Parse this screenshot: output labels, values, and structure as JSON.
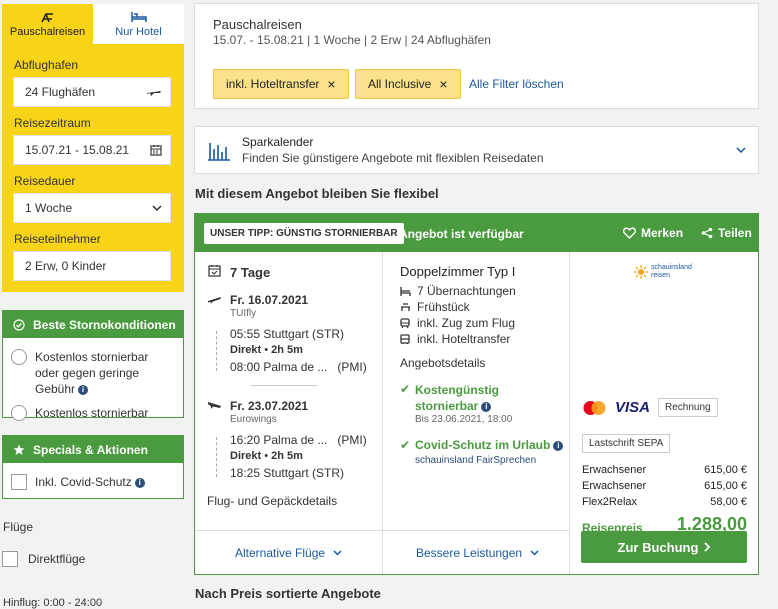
{
  "sidebar": {
    "tabs": [
      {
        "label": "Pauschalreisen",
        "icon": "beach-chair-icon",
        "active": true
      },
      {
        "label": "Nur Hotel",
        "icon": "bed-icon",
        "active": false
      }
    ],
    "fields": [
      {
        "label": "Abflughafen",
        "value": "24 Flughäfen",
        "icon": "plane-icon"
      },
      {
        "label": "Reisezeitraum",
        "value": "15.07.21 - 15.08.21",
        "icon": "calendar-icon"
      },
      {
        "label": "Reisedauer",
        "value": "1 Woche",
        "icon": "chevron-down-icon"
      },
      {
        "label": "Reiseteilnehmer",
        "value": "2 Erw, 0 Kinder",
        "icon": ""
      }
    ],
    "storno": {
      "title": "Beste Stornokonditionen",
      "options": [
        "Kostenlos stornierbar oder gegen geringe Gebühr",
        "Kostenlos stornierbar"
      ]
    },
    "specials": {
      "title": "Specials & Aktionen",
      "options": [
        "Inkl. Covid-Schutz"
      ]
    },
    "fluege": {
      "title": "Flüge",
      "direct": "Direktflüge",
      "hinflug": "Hinflug: 0:00 - 24:00"
    }
  },
  "summary": {
    "title": "Pauschalreisen",
    "details": "15.07. - 15.08.21 | 1 Woche | 2 Erw | 24 Abflughäfen",
    "chips": [
      "inkl. Hoteltransfer",
      "All Inclusive"
    ],
    "clear_filters": "Alle Filter löschen"
  },
  "sparkalender": {
    "title": "Sparkalender",
    "subtitle": "Finden Sie günstigere Angebote mit flexiblen Reisedaten"
  },
  "flex_heading": "Mit diesem Angebot bleiben Sie flexibel",
  "offer": {
    "badge": "UNSER TIPP: GÜNSTIG STORNIERBAR",
    "available": "Angebot ist verfügbar",
    "save": "Merken",
    "share": "Teilen",
    "duration": "7 Tage",
    "outbound": {
      "date": "Fr. 16.07.2021",
      "airline": "TUIfly",
      "dep_time_place": "05:55 Stuttgart (STR)",
      "direct": "Direkt",
      "duration": "2h 5m",
      "arr_time_place": "08:00 Palma de ...",
      "arr_code": "(PMI)"
    },
    "inbound": {
      "date": "Fr. 23.07.2021",
      "airline": "Eurowings",
      "dep_time_place": "16:20 Palma de ...",
      "dep_code": "(PMI)",
      "direct": "Direkt",
      "duration": "2h 5m",
      "arr_time_place": "18:25 Stuttgart (STR)"
    },
    "flight_details": "Flug- und Gepäckdetails",
    "alt_flights": "Alternative Flüge",
    "room": "Doppelzimmer Typ I",
    "features": [
      "7 Übernachtungen",
      "Frühstück",
      "inkl. Zug zum Flug",
      "inkl. Hoteltransfer"
    ],
    "offer_details": "Angebotsdetails",
    "cancel_title": "Kostengünstig stornierbar",
    "cancel_until": "Bis 23.06.2021, 18:00",
    "covid_title": "Covid-Schutz im Urlaub",
    "covid_sub": "schauinsland FairSprechen",
    "better_services": "Bessere Leistungen",
    "operator": "schauinsland reisen",
    "payment": [
      "VISA",
      "Rechnung",
      "Lastschrift SEPA"
    ],
    "prices": [
      {
        "label": "Erwachsener",
        "value": "615,00 €"
      },
      {
        "label": "Erwachsener",
        "value": "615,00 €"
      },
      {
        "label": "Flex2Relax",
        "value": "58,00 €"
      }
    ],
    "total_label": "Reisepreis",
    "total_value": "1.288,00 €",
    "book_button": "Zur Buchung"
  },
  "sorted_heading": "Nach Preis sortierte Angebote",
  "colors": {
    "yellow": "#f7d417",
    "green": "#4a9a3f",
    "link": "#1a5aa0",
    "chip": "#fbe28a"
  }
}
